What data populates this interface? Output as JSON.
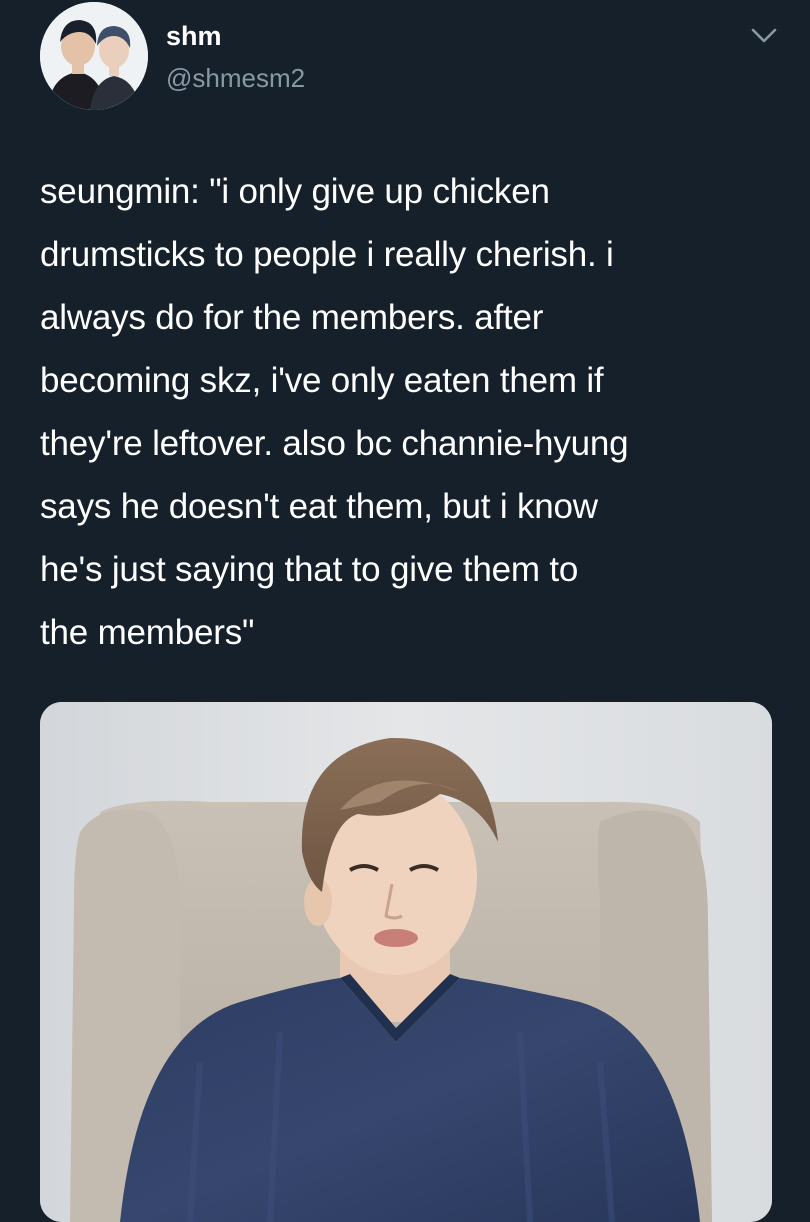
{
  "tweet": {
    "author": {
      "display_name": "shm",
      "handle": "@shmesm2",
      "avatar_icon": "profile-photo"
    },
    "menu_icon": "chevron-down-icon",
    "text": "seungmin: \"i only give up chicken drumsticks to people i really cherish. i always do for the members. after becoming skz, i've only eaten them if they're leftover. also bc channie-hyung says he doesn't eat them, but i know he's just saying that to give them to the members\"",
    "text_lines": [
      "seungmin: \"i only give up chicken",
      "drumsticks to people i really cherish. i",
      "always do for the members. after",
      "becoming skz, i've only eaten them if",
      "they're leftover. also bc channie-hyung",
      "says he doesn't eat them, but i know",
      "he's just saying that to give them to",
      "the members\""
    ],
    "media": {
      "type": "photo"
    }
  },
  "colors": {
    "background": "#15202b",
    "text_primary": "#ffffff",
    "text_secondary": "#8899a6"
  }
}
